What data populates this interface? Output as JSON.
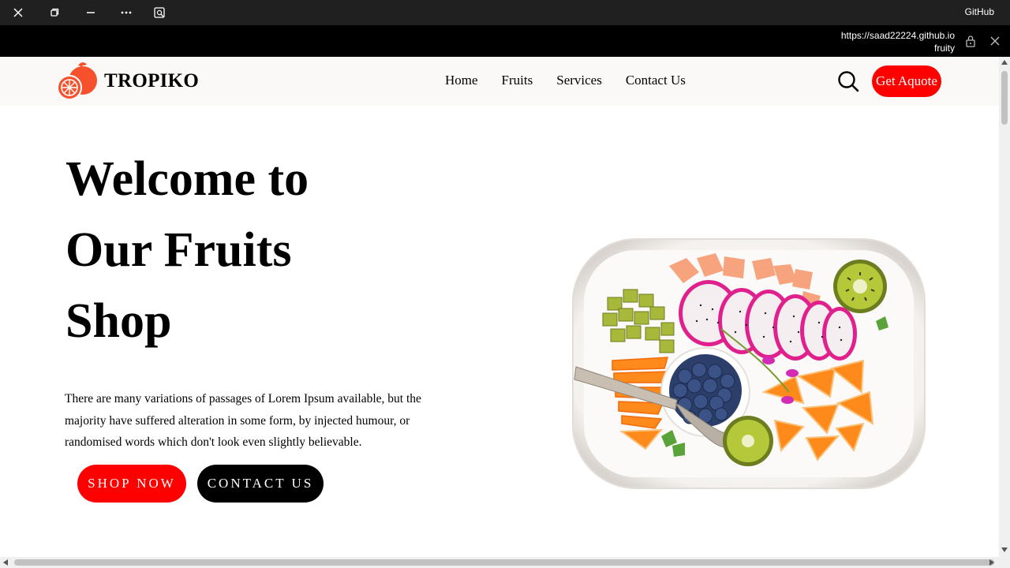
{
  "window": {
    "app_name": "GitHub",
    "url_line1": "https://saad22224.github.io",
    "url_line2": "fruity"
  },
  "nav": {
    "brand": "TROPIKO",
    "links": [
      "Home",
      "Fruits",
      "Services",
      "Contact Us"
    ],
    "quote_label": "Get Aquote"
  },
  "hero": {
    "title_lines": [
      "Welcome to",
      "Our Fruits",
      "Shop"
    ],
    "description": "There are many variations of passages of Lorem Ipsum available, but the majority have suffered alteration in some form, by injected humour, or randomised words which don't look even slightly believable.",
    "shop_label": "SHOP NOW",
    "contact_label": "CONTACT US"
  },
  "colors": {
    "accent": "#ff0000",
    "dark": "#000000",
    "nav_bg": "#faf9f7"
  },
  "icons": [
    "close-icon",
    "restore-icon",
    "minimize-icon",
    "more-icon",
    "reader-icon",
    "lock-icon",
    "search-icon",
    "orange-logo-icon"
  ]
}
